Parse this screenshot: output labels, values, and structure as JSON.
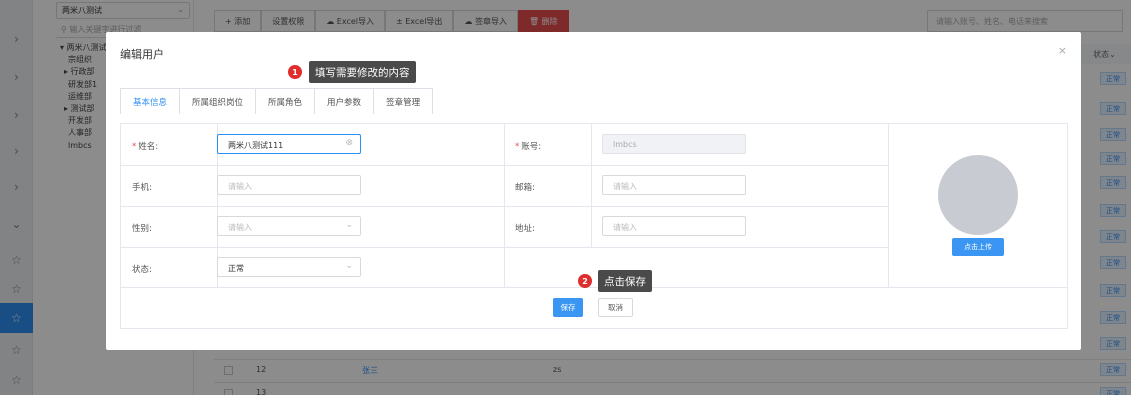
{
  "nav_icons": [
    "chevron-right-icon",
    "chevron-right-icon",
    "chevron-right-icon",
    "chevron-right-icon",
    "chevron-right-icon",
    "chevron-down-icon",
    "star-icon",
    "star-icon",
    "star-icon",
    "star-icon",
    "star-icon"
  ],
  "tree": {
    "org_select": "两米八测试",
    "search_placeholder": "输入关键字进行过滤",
    "nodes": [
      "▾ 两米八测试",
      "  宗组织",
      "  ▸ 行政部",
      "  研发部1",
      "  运维部",
      "  ▸ 测试部",
      "  开发部",
      "  人事部",
      "  lmbcs"
    ]
  },
  "toolbar": {
    "add": "+ 添加",
    "permissions": "设置权限",
    "excel_import": "☁ Excel导入",
    "excel_export": "± Excel导出",
    "sign_import": "☁ 签章导入",
    "delete": "🗑 删除"
  },
  "top_search_placeholder": "请输入账号、姓名、电话来搜索",
  "status_column": {
    "header": "状态",
    "tag": "正常"
  },
  "table_rows": [
    {
      "no": "12",
      "name": "张三",
      "account": "zs"
    },
    {
      "no": "13",
      "name": "",
      "account": ""
    }
  ],
  "dialog": {
    "title": "编辑用户",
    "tabs": [
      "基本信息",
      "所属组织岗位",
      "所属角色",
      "用户参数",
      "签章管理"
    ],
    "fields": {
      "name_label": "姓名:",
      "name_value": "两米八测试111",
      "account_label": "账号:",
      "account_value": "lmbcs",
      "phone_label": "手机:",
      "phone_placeholder": "请输入",
      "email_label": "邮箱:",
      "email_placeholder": "请输入",
      "gender_label": "性别:",
      "gender_placeholder": "请输入",
      "address_label": "地址:",
      "address_placeholder": "请输入",
      "status_label": "状态:",
      "status_value": "正常"
    },
    "upload_label": "点击上传",
    "save_label": "保存",
    "cancel_label": "取消"
  },
  "annotations": {
    "step1_number": "1",
    "step1_text": "填写需要修改的内容",
    "step2_number": "2",
    "step2_text": "点击保存"
  },
  "colors": {
    "primary": "#2e8ff2",
    "danger": "#e54e4e",
    "badge": "#e02e2e",
    "tooltip": "#4a4a4a"
  }
}
